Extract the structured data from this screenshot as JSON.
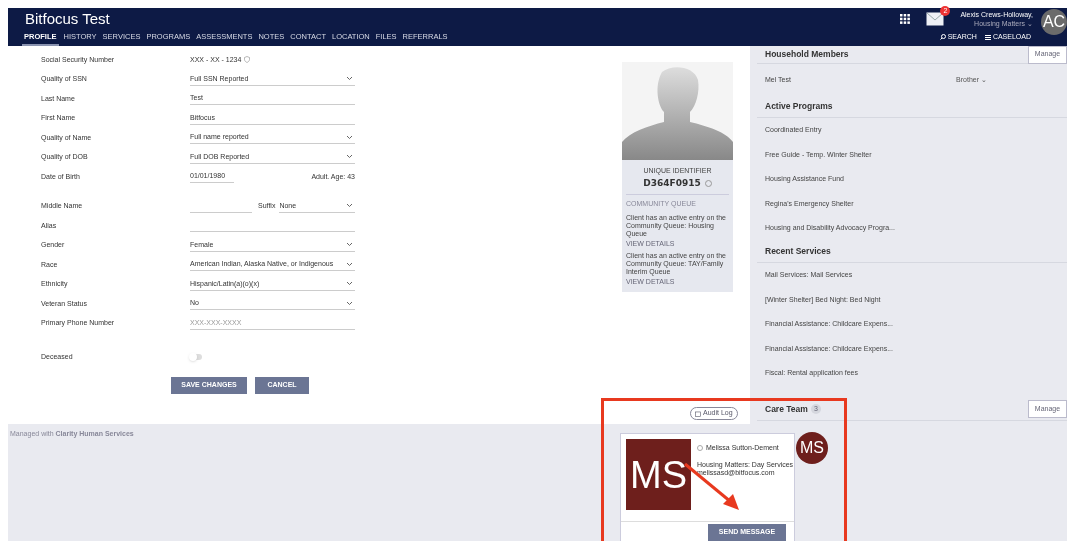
{
  "header": {
    "title": "Bitfocus Test",
    "tabs": [
      {
        "label": "PROFILE",
        "selected": true
      },
      {
        "label": "HISTORY",
        "selected": false
      },
      {
        "label": "SERVICES",
        "selected": false
      },
      {
        "label": "PROGRAMS",
        "selected": false
      },
      {
        "label": "ASSESSMENTS",
        "selected": false
      },
      {
        "label": "NOTES",
        "selected": false
      },
      {
        "label": "CONTACT",
        "selected": false
      },
      {
        "label": "LOCATION",
        "selected": false
      },
      {
        "label": "FILES",
        "selected": false
      },
      {
        "label": "REFERRALS",
        "selected": false
      }
    ],
    "mail_count": "2",
    "user_name": "Alexis Crews-Holloway,",
    "user_org": "Housing Matters ⌄",
    "avatar": "AC",
    "search": "SEARCH",
    "caseload": "CASELOAD"
  },
  "form": {
    "rows": [
      {
        "kind": "ssn",
        "label": "Social Security Number",
        "value": "XXX - XX - 1234"
      },
      {
        "kind": "select",
        "label": "Quality of SSN",
        "value": "Full SSN Reported"
      },
      {
        "kind": "text",
        "label": "Last Name",
        "value": "Test"
      },
      {
        "kind": "text",
        "label": "First Name",
        "value": "Bitfocus"
      },
      {
        "kind": "select",
        "label": "Quality of Name",
        "value": "Full name reported"
      },
      {
        "kind": "select",
        "label": "Quality of DOB",
        "value": "Full DOB Reported"
      },
      {
        "kind": "dob",
        "label": "Date of Birth",
        "value": "01/01/1980",
        "age": "Adult. Age: 43"
      },
      {
        "kind": "middle",
        "label": "Middle Name",
        "suffix_label": "Suffix",
        "suffix": "None"
      },
      {
        "kind": "text",
        "label": "Alias"
      },
      {
        "kind": "select",
        "label": "Gender",
        "value": "Female"
      },
      {
        "kind": "select",
        "label": "Race",
        "value": "American Indian, Alaska Native, or Indigenous"
      },
      {
        "kind": "select",
        "label": "Ethnicity",
        "value": "Hispanic/Latin(a)(o)(x)"
      },
      {
        "kind": "select",
        "label": "Veteran Status",
        "value": "No"
      },
      {
        "kind": "text",
        "label": "Primary Phone Number",
        "placeholder": "XXX-XXX-XXXX"
      },
      {
        "kind": "toggle",
        "label": "Deceased",
        "on": false
      }
    ],
    "buttons": [
      "SAVE CHANGES",
      "CANCEL"
    ]
  },
  "profile_card": {
    "uid_label": "UNIQUE IDENTIFIER",
    "uid": "D364F0915",
    "queue_title": "COMMUNITY QUEUE",
    "entries": [
      {
        "text": "Client has an active entry on the Community Queue: Housing Queue",
        "link": "VIEW DETAILS"
      },
      {
        "text": "Client has an active entry on the Community Queue: TAY/Family Interim Queue",
        "link": "VIEW DETAILS"
      }
    ]
  },
  "household": {
    "title": "Household Members",
    "manage": "Manage",
    "members": [
      {
        "name": "Mel Test",
        "relation": "Brother ⌄"
      }
    ]
  },
  "active_programs": {
    "title": "Active Programs",
    "items": [
      "Coordinated Entry",
      "Free Guide - Temp. Winter Shelter",
      "Housing Assistance Fund",
      "Regina's Emergency Shelter",
      "Housing and Disability Advocacy Progra..."
    ]
  },
  "recent_services": {
    "title": "Recent Services",
    "items": [
      "Mail Services: Mail Services",
      "[Winter Shelter] Bed Night: Bed Night",
      "Financial Assistance: Childcare Expens...",
      "Financial Assistance: Childcare Expens...",
      "Fiscal: Rental application fees"
    ]
  },
  "care_team": {
    "title": "Care Team",
    "count": "3",
    "manage": "Manage",
    "avatar": "MS"
  },
  "audit_log": "Audit Log",
  "footer": "Managed with **Clarity Human Services**",
  "popup": {
    "initials": "MS",
    "name": "Melissa Sutton-Dement",
    "org": "Housing Matters: Day Services",
    "email": "melissasd@bitfocus.com",
    "button": "SEND MESSAGE",
    "checked": false
  }
}
